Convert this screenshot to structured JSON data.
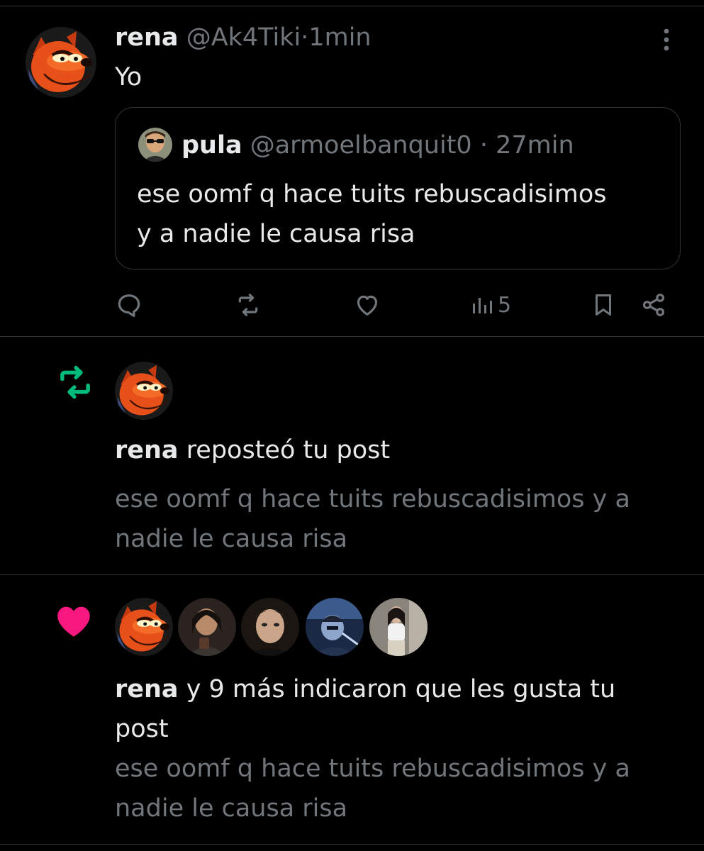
{
  "tweet": {
    "author_name": "rena",
    "author_handle": "@Ak4Tiki",
    "separator": "·",
    "time": "1min",
    "text": "Yo",
    "quote": {
      "author_name": "pula",
      "author_handle": "@armoelbanquit0",
      "time": "27min",
      "text_line1": "ese oomf q hace tuits rebuscadisimos",
      "text_line2": "y a nadie le causa risa"
    },
    "actions": {
      "views": "5"
    }
  },
  "repost_notification": {
    "actor": "rena",
    "action_text": "reposteó tu post",
    "preview_line1": "ese oomf q hace tuits rebuscadisimos y a",
    "preview_line2": "nadie le causa risa"
  },
  "like_notification": {
    "actor": "rena",
    "action_text_line1": "y 9 más indicaron que les gusta tu",
    "action_text_line2": "post",
    "preview_line1": "ese oomf q hace tuits rebuscadisimos y a",
    "preview_line2": "nadie le causa risa"
  },
  "colors": {
    "background": "#000000",
    "text_primary": "#e7e9ea",
    "text_secondary": "#71767b",
    "divider": "#2f3336",
    "repost_green": "#00ba7c",
    "like_pink": "#f91880"
  }
}
